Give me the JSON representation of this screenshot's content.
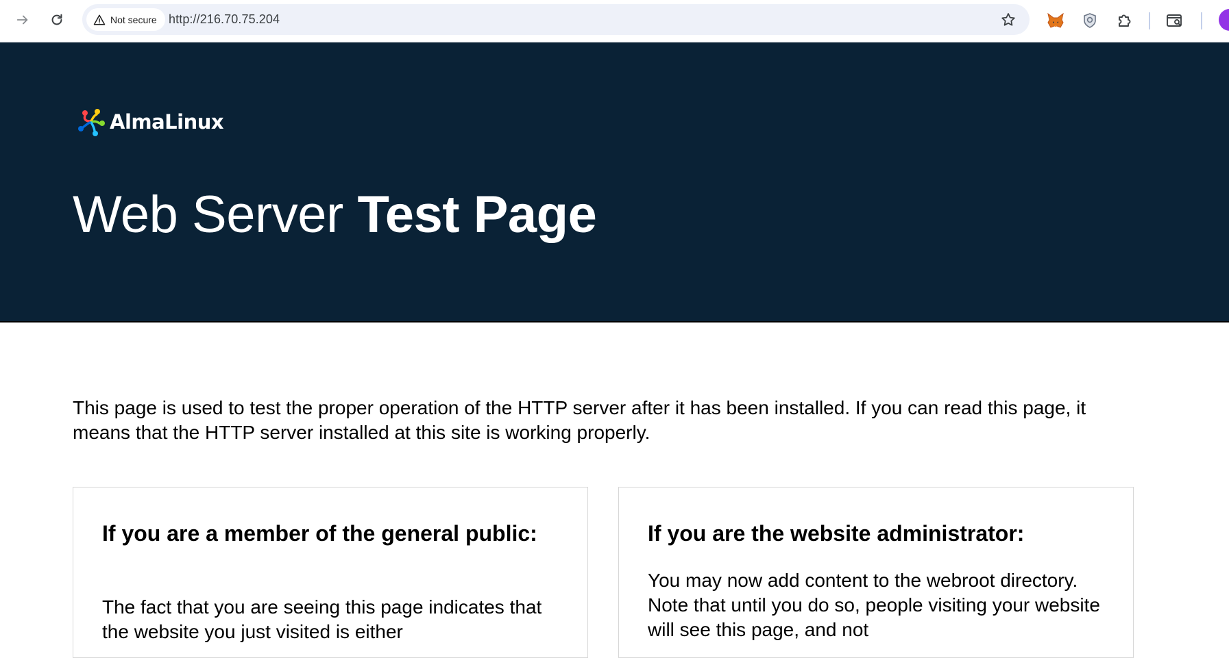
{
  "browser": {
    "security_label": "Not secure",
    "url": "http://216.70.75.204",
    "icons": [
      "back-arrow-icon",
      "reload-icon",
      "warning-icon",
      "bookmark-star-icon",
      "fox-extension-icon",
      "shield-extension-icon",
      "puzzle-extensions-icon",
      "search-tabs-icon"
    ],
    "colors": {
      "omnibox_bg": "#eef1f9",
      "avatar": "#9334e6"
    }
  },
  "hero": {
    "logo_text": "AlmaLinux",
    "title_light": "Web Server ",
    "title_bold": "Test Page",
    "bg_color": "#0a2236"
  },
  "intro": {
    "text": "This page is used to test the proper operation of the HTTP server after it has been installed. If you can read this page, it means that the HTTP server installed at this site is working properly."
  },
  "cards": [
    {
      "heading": "If you are a member of the general public:",
      "body": "The fact that you are seeing this page indicates that the website you just visited is either"
    },
    {
      "heading": "If you are the website administrator:",
      "body": "You may now add content to the webroot directory. Note that until you do so, people visiting your website will see this page, and not"
    }
  ]
}
